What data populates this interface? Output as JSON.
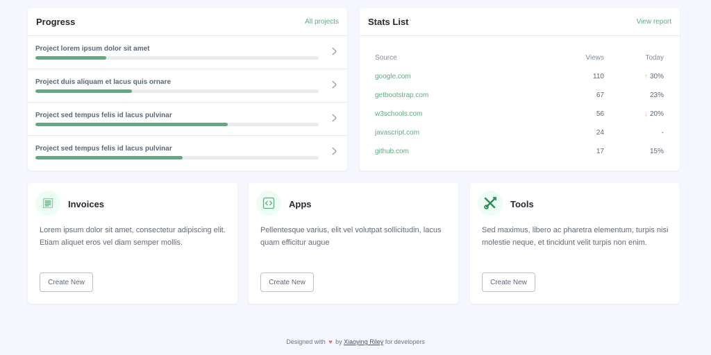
{
  "progress": {
    "title": "Progress",
    "link_label": "All projects",
    "items": [
      {
        "label": "Project lorem ipsum dolor sit amet",
        "percent": 25
      },
      {
        "label": "Project duis aliquam et lacus quis ornare",
        "percent": 34
      },
      {
        "label": "Project sed tempus felis id lacus pulvinar",
        "percent": 68
      },
      {
        "label": "Project sed tempus felis id lacus pulvinar",
        "percent": 52
      }
    ]
  },
  "stats": {
    "title": "Stats List",
    "link_label": "View report",
    "headers": {
      "source": "Source",
      "views": "Views",
      "today": "Today"
    },
    "rows": [
      {
        "source": "google.com",
        "views": "110",
        "today": "30%",
        "trend": "up"
      },
      {
        "source": "getbootstrap.com",
        "views": "67",
        "today": "23%",
        "trend": ""
      },
      {
        "source": "w3schools.com",
        "views": "56",
        "today": "20%",
        "trend": "down"
      },
      {
        "source": "javascript.com",
        "views": "24",
        "today": "-",
        "trend": ""
      },
      {
        "source": "github.com",
        "views": "17",
        "today": "15%",
        "trend": ""
      }
    ],
    "trend_icons": {
      "up": "↑",
      "down": "↓"
    }
  },
  "apps": [
    {
      "title": "Invoices",
      "icon": "receipt-icon",
      "description": "Lorem ipsum dolor sit amet, consectetur adipiscing elit. Etiam aliquet eros vel diam semper mollis.",
      "button_label": "Create New"
    },
    {
      "title": "Apps",
      "icon": "code-square-icon",
      "description": "Pellentesque varius, elit vel volutpat sollicitudin, lacus quam efficitur augue",
      "button_label": "Create New"
    },
    {
      "title": "Tools",
      "icon": "tools-icon",
      "description": "Sed maximus, libero ac pharetra elementum, turpis nisi molestie neque, et tincidunt velit turpis non enim.",
      "button_label": "Create New"
    }
  ],
  "footer": {
    "prefix": "Designed with",
    "by": "by",
    "author": "Xiaoying Riley",
    "suffix": "for developers"
  },
  "colors": {
    "accent": "#5fab80",
    "icon_bg": "#edfdf6",
    "progress_track": "#e9ecef",
    "trend_up": "#a3d4b9",
    "trend_down": "#e6a4b4",
    "heart": "#ea6e59"
  }
}
